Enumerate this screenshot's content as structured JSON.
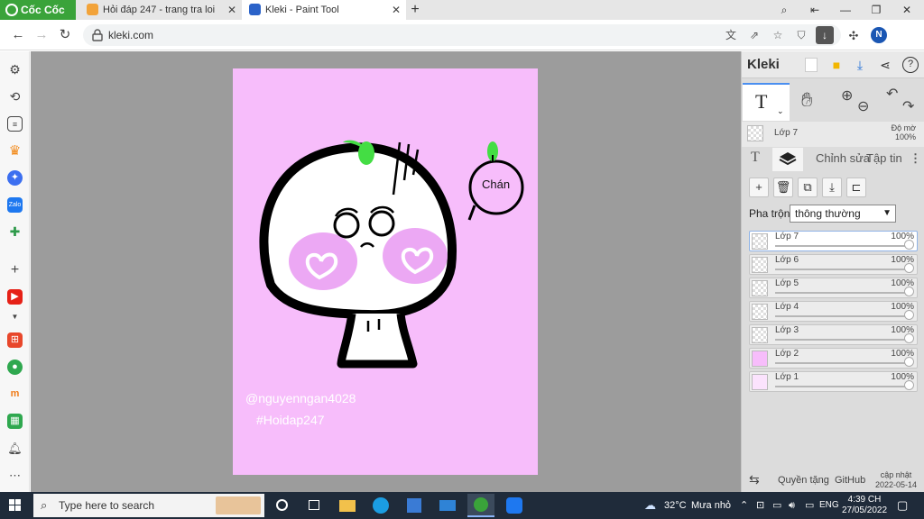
{
  "browser": {
    "brand": "Cốc Cốc",
    "tabs": [
      {
        "title": "Hỏi đáp 247 - trang tra loi",
        "active": false
      },
      {
        "title": "Kleki - Paint Tool",
        "active": true
      }
    ],
    "url": "kleki.com",
    "profile_initial": "N"
  },
  "artwork": {
    "bubble_text": "Chán",
    "watermark_line1": "@nguyenngan4028",
    "watermark_line2": "#Hoidap247",
    "background_color": "#f7bdfb"
  },
  "kleki": {
    "logo": "Kleki",
    "current_layer_name": "Lớp 7",
    "opacity_label": "Độ mờ",
    "opacity_value": "100%",
    "tabs": {
      "text": "T",
      "edit": "Chỉnh sửa",
      "file": "Tập tin"
    },
    "blend_label": "Pha trộn",
    "blend_value": "thông thường",
    "layers": [
      {
        "name": "Lớp 7",
        "opacity": "100%",
        "selected": true
      },
      {
        "name": "Lớp 6",
        "opacity": "100%",
        "selected": false
      },
      {
        "name": "Lớp 5",
        "opacity": "100%",
        "selected": false
      },
      {
        "name": "Lớp 4",
        "opacity": "100%",
        "selected": false
      },
      {
        "name": "Lớp 3",
        "opacity": "100%",
        "selected": false
      },
      {
        "name": "Lớp 2",
        "opacity": "100%",
        "selected": false
      },
      {
        "name": "Lớp 1",
        "opacity": "100%",
        "selected": false
      }
    ],
    "footer": {
      "privacy": "Quyền tặng",
      "github": "GitHub",
      "update_label": "cập nhật",
      "update_date": "2022-05-14"
    }
  },
  "taskbar": {
    "search_placeholder": "Type here to search",
    "weather_temp": "32°C",
    "weather_desc": "Mưa nhỏ",
    "language": "ENG",
    "time": "4:39 CH",
    "date": "27/05/2022"
  },
  "colors": {
    "accent": "#4a8ff0",
    "brand": "#3aa33a",
    "taskbar": "#1f2b3a"
  }
}
